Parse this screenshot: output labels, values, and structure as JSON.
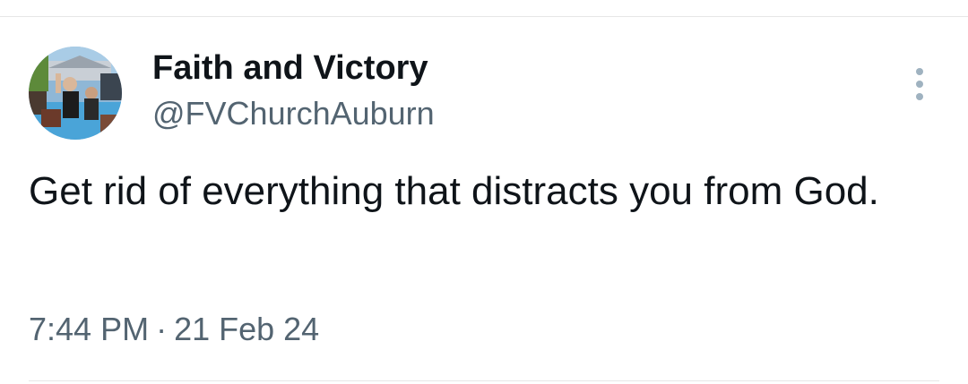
{
  "author": {
    "display_name": "Faith and Victory",
    "handle": "@FVChurchAuburn",
    "avatar_icon": "profile-photo"
  },
  "tweet": {
    "text": "Get rid of everything that distracts you from God.",
    "time": "7:44 PM",
    "separator": "·",
    "date": "21 Feb 24"
  },
  "more_menu_icon": "vertical-ellipsis-icon",
  "colors": {
    "primary_text": "#0f1419",
    "secondary_text": "#536471",
    "divider": "#e6e6e6",
    "menu_dots": "#9fb2c0"
  }
}
